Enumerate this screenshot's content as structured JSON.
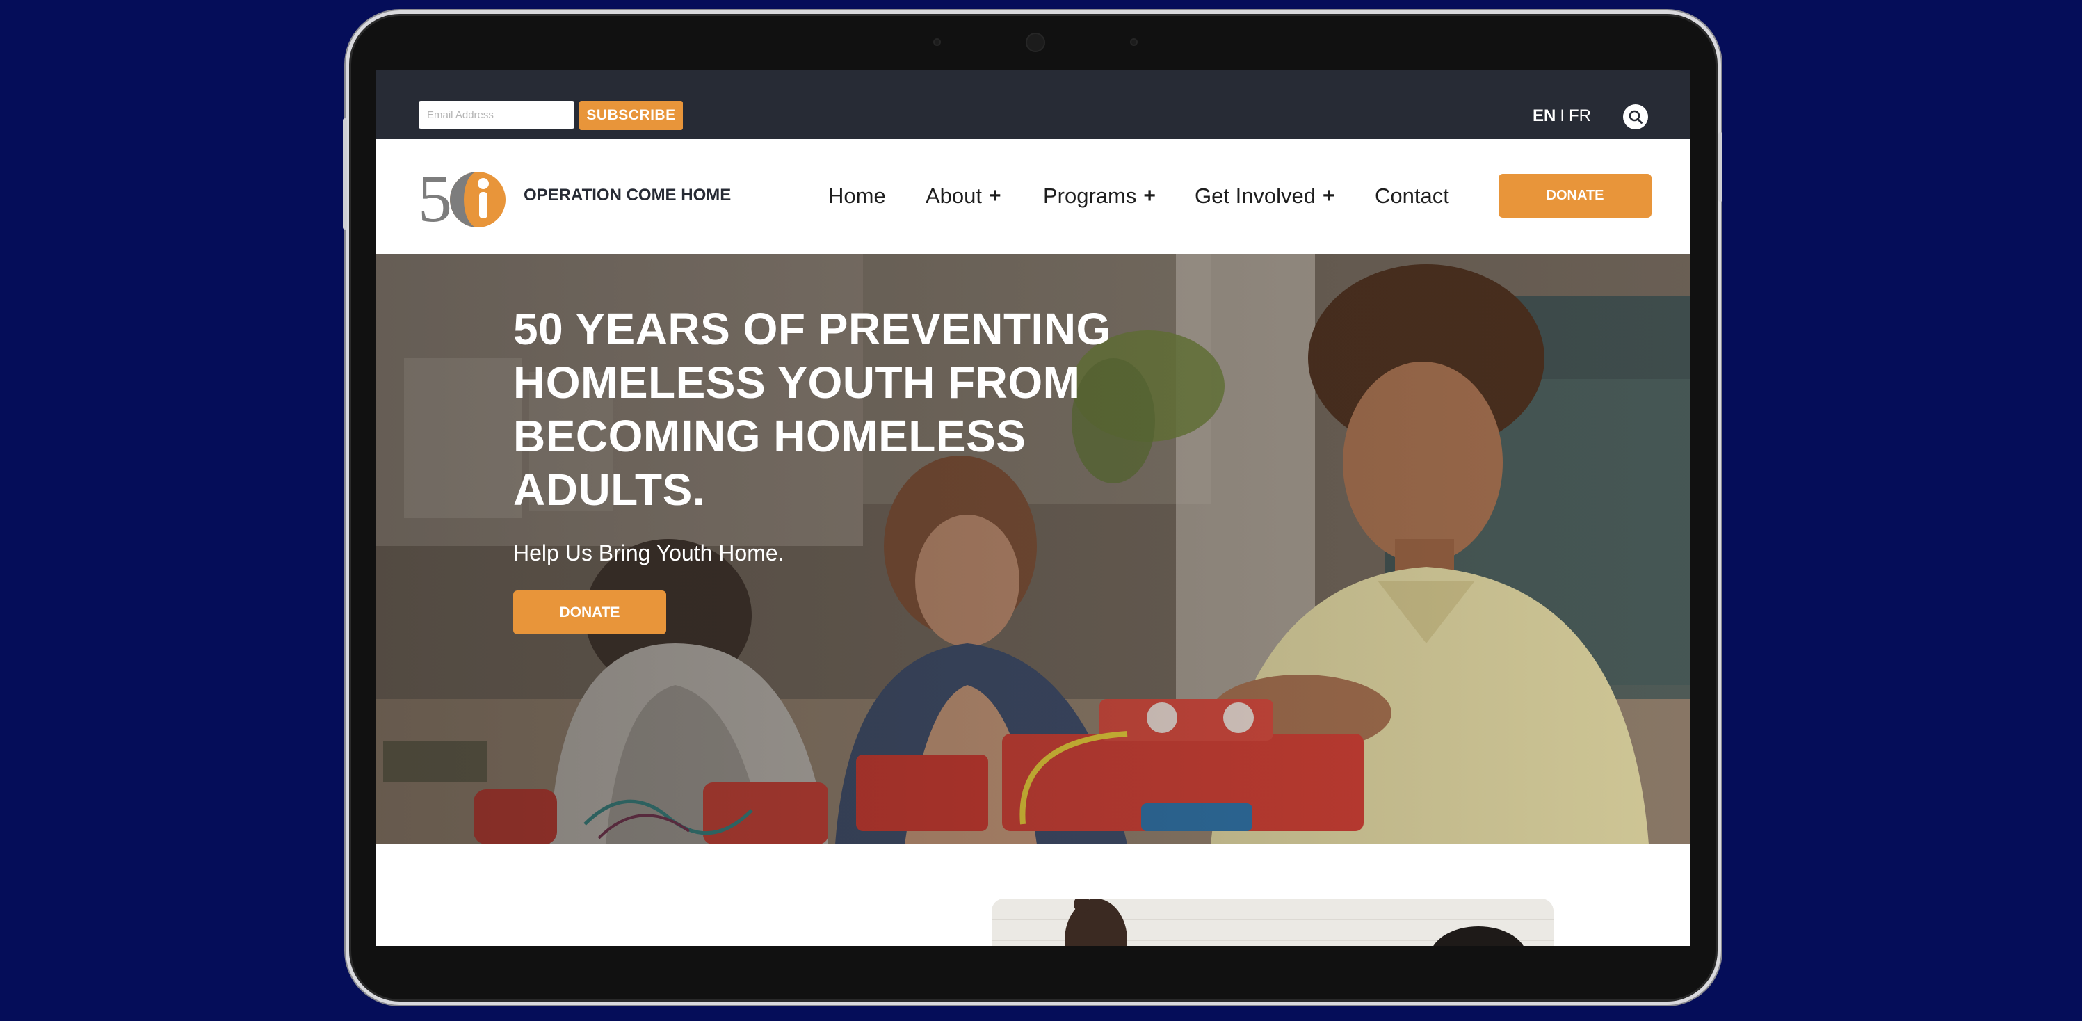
{
  "topbar": {
    "email_placeholder": "Email Address",
    "subscribe_label": "SUBSCRIBE",
    "lang_en": "EN",
    "lang_sep": "I",
    "lang_fr": "FR"
  },
  "navbar": {
    "brand_name": "OPERATION COME HOME",
    "items": [
      {
        "label": "Home",
        "expandable": false
      },
      {
        "label": "About",
        "expandable": true
      },
      {
        "label": "Programs",
        "expandable": true
      },
      {
        "label": "Get Involved",
        "expandable": true
      },
      {
        "label": "Contact",
        "expandable": false
      }
    ],
    "plus_glyph": "+",
    "donate_label": "DONATE"
  },
  "hero": {
    "title": "50 YEARS OF PREVENTING HOMELESS YOUTH FROM BECOMING HOMELESS ADULTS.",
    "subtitle": "Help Us Bring Youth Home.",
    "donate_label": "DONATE"
  },
  "colors": {
    "accent": "#e8953a",
    "topbar_bg": "#272b35",
    "page_bg": "#050d59",
    "text_dark": "#1e1e1e"
  }
}
